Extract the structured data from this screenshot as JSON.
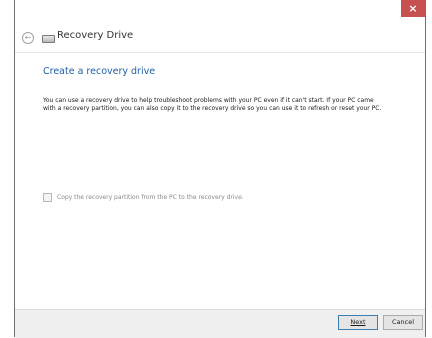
{
  "window": {
    "close_glyph": "×",
    "back_glyph": "←",
    "app_title": "Recovery Drive",
    "icons": [
      "back-arrow-icon",
      "drive-icon",
      "close-icon"
    ]
  },
  "page": {
    "heading": "Create a recovery drive",
    "description": "You can use a recovery drive to help troubleshoot problems with your PC even if it can't start. If your PC came with a recovery partition, you can also copy it to the recovery drive so you can use it to refresh or reset your PC.",
    "checkbox_label": "Copy the recovery partition from the PC to the recovery drive.",
    "checkbox_checked": false,
    "checkbox_enabled": false
  },
  "footer": {
    "next_label": "Next",
    "cancel_label": "Cancel"
  },
  "colors": {
    "accent": "#1e5fa8",
    "close": "#c75050"
  }
}
